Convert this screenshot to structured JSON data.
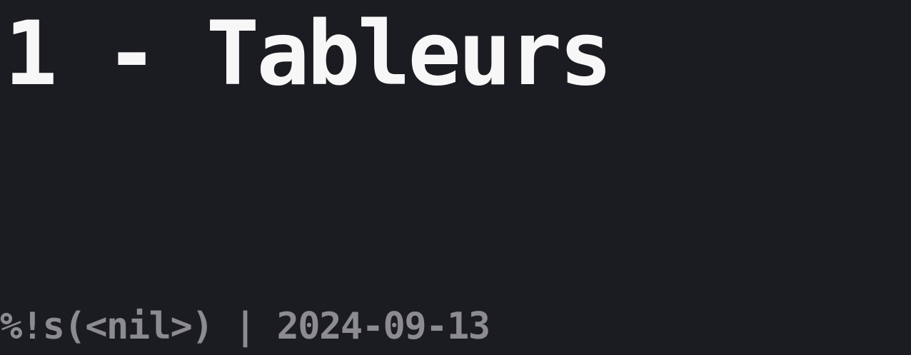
{
  "post": {
    "title": "1 - Tableurs",
    "author": "%!s(<nil>)",
    "separator": " | ",
    "date": "2024-09-13"
  },
  "colors": {
    "background": "#1b1c21",
    "title": "#f7f7f8",
    "meta": "#8b8b90"
  }
}
